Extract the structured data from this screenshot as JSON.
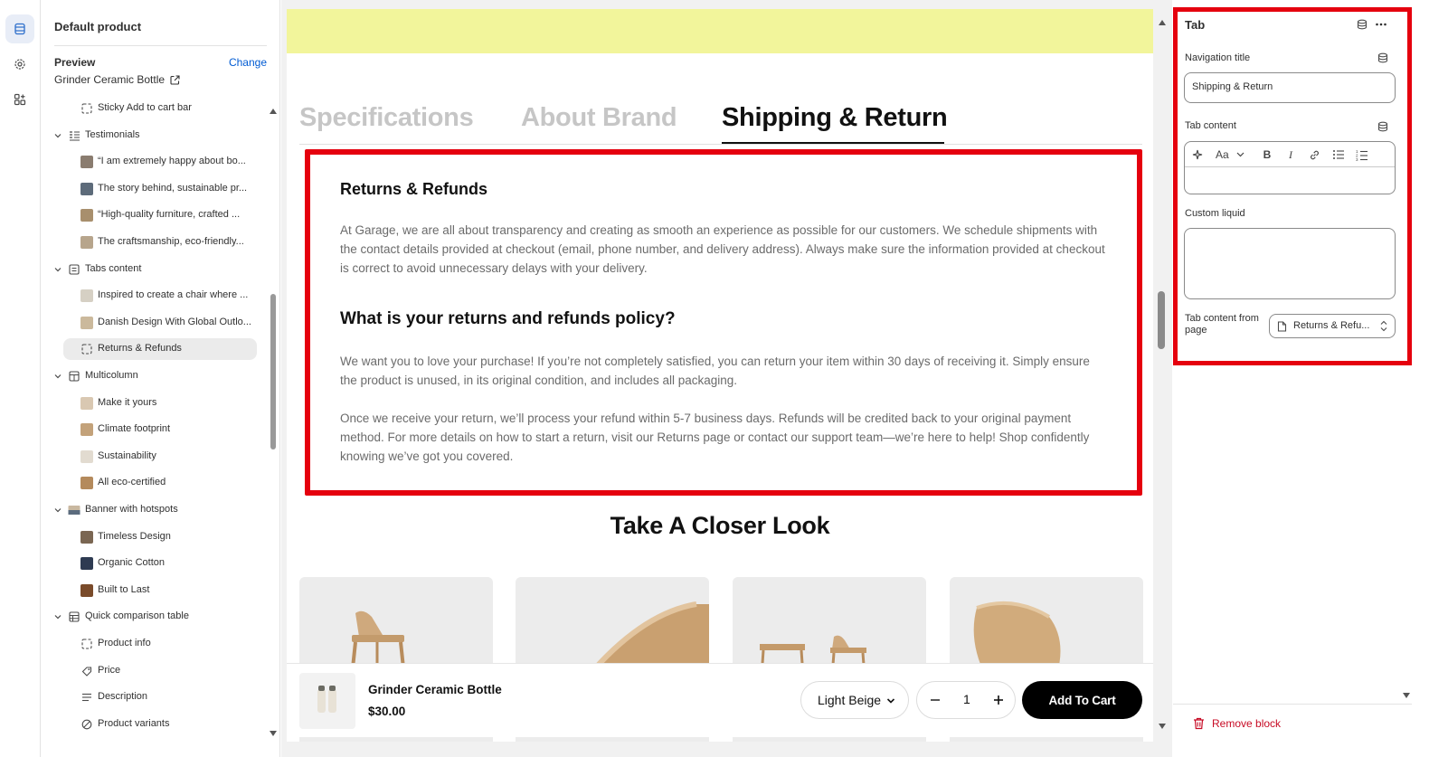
{
  "left_panel": {
    "title": "Default product",
    "preview_label": "Preview",
    "change_label": "Change",
    "preview_product": "Grinder Ceramic Bottle",
    "tree": [
      {
        "label": "Sticky Add to cart bar",
        "level": 2,
        "icon": "block-dashed-icon"
      },
      {
        "label": "Testimonials",
        "level": 1,
        "icon": "testimonials-section-icon"
      },
      {
        "label": "“I am extremely happy about bo...",
        "level": 2,
        "icon": "image-thumb"
      },
      {
        "label": "The story behind, sustainable pr...",
        "level": 2,
        "icon": "image-thumb"
      },
      {
        "label": "“High-quality furniture, crafted ...",
        "level": 2,
        "icon": "image-thumb"
      },
      {
        "label": "The craftsmanship, eco-friendly...",
        "level": 2,
        "icon": "image-thumb"
      },
      {
        "label": "Tabs content",
        "level": 1,
        "icon": "tabs-section-icon"
      },
      {
        "label": "Inspired to create a chair where ...",
        "level": 2,
        "icon": "image-thumb"
      },
      {
        "label": "Danish Design With Global Outlo...",
        "level": 2,
        "icon": "image-thumb"
      },
      {
        "label": "Returns & Refunds",
        "level": 2,
        "icon": "block-dashed-icon",
        "selected": true
      },
      {
        "label": "Multicolumn",
        "level": 1,
        "icon": "multicolumn-section-icon"
      },
      {
        "label": "Make it yours",
        "level": 2,
        "icon": "image-thumb"
      },
      {
        "label": "Climate footprint",
        "level": 2,
        "icon": "image-thumb"
      },
      {
        "label": "Sustainability",
        "level": 2,
        "icon": "image-thumb"
      },
      {
        "label": "All eco-certified",
        "level": 2,
        "icon": "image-thumb"
      },
      {
        "label": "Banner with hotspots",
        "level": 1,
        "icon": "banner-section-icon"
      },
      {
        "label": "Timeless Design",
        "level": 2,
        "icon": "image-thumb"
      },
      {
        "label": "Organic Cotton",
        "level": 2,
        "icon": "image-thumb"
      },
      {
        "label": "Built to Last",
        "level": 2,
        "icon": "image-thumb"
      },
      {
        "label": "Quick comparison table",
        "level": 1,
        "icon": "table-section-icon"
      },
      {
        "label": "Product info",
        "level": 2,
        "icon": "block-dashed-icon"
      },
      {
        "label": "Price",
        "level": 2,
        "icon": "price-tag-icon"
      },
      {
        "label": "Description",
        "level": 2,
        "icon": "text-lines-icon"
      },
      {
        "label": "Product variants",
        "level": 2,
        "icon": "variants-icon"
      }
    ]
  },
  "canvas": {
    "tabs": [
      {
        "label": "Specifications",
        "active": false
      },
      {
        "label": "About Brand",
        "active": false
      },
      {
        "label": "Shipping & Return",
        "active": true
      }
    ],
    "content": {
      "heading1": "Returns & Refunds",
      "paragraph1": "At Garage, we are all about transparency and creating as smooth an experience as possible for our customers. We schedule shipments with the contact details provided at checkout (email, phone number, and delivery address). Always make sure the information provided at checkout is correct to avoid unnecessary delays with your delivery.",
      "heading2": "What is your returns and refunds policy?",
      "paragraph2": "We want you to love your purchase! If you’re not completely satisfied, you can return your item within 30 days of receiving it. Simply ensure the product is unused, in its original condition, and includes all packaging.",
      "paragraph3": "Once we receive your return, we’ll process your refund within 5-7 business days. Refunds will be credited back to your original payment method. For more details on how to start a return, visit our Returns page or contact our support team—we’re here to help! Shop confidently knowing we’ve got you covered."
    },
    "closer_look_title": "Take A Closer Look",
    "sticky_bar": {
      "product_name": "Grinder Ceramic Bottle",
      "price": "$30.00",
      "variant": "Light Beige",
      "quantity": "1",
      "add_to_cart": "Add To Cart"
    }
  },
  "right_panel": {
    "title": "Tab",
    "navigation_title_label": "Navigation title",
    "navigation_title_value": "Shipping & Return",
    "tab_content_label": "Tab content",
    "custom_liquid_label": "Custom liquid",
    "tab_content_from_page_label": "Tab content from page",
    "tab_content_from_page_value": "Returns & Refu...",
    "remove_block": "Remove block"
  },
  "colors": {
    "highlight_red": "#e5000e",
    "link_blue": "#005bd3",
    "banner_yellow": "#f2f59b",
    "remove_red": "#c70a24"
  }
}
